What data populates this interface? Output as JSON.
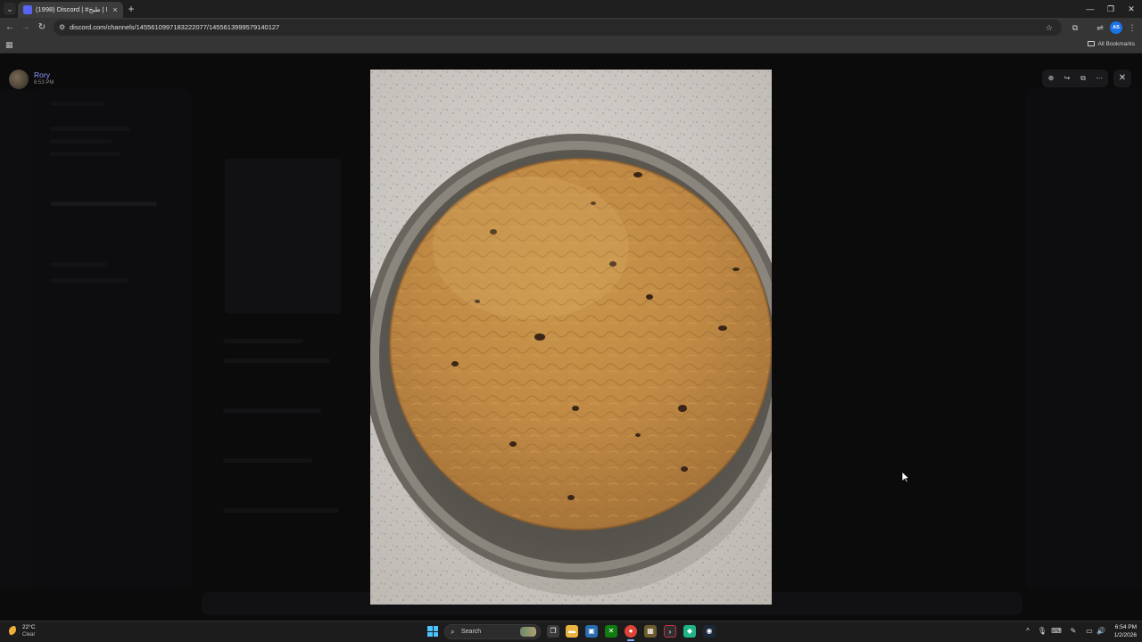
{
  "browser": {
    "tab": {
      "title": "(1998) Discord | #طبخ | MWV1...",
      "close": "×"
    },
    "new_tab": "+",
    "window_controls": {
      "minimize": "—",
      "restore": "❐",
      "close": "✕"
    },
    "nav": {
      "back": "←",
      "forward": "→",
      "reload": "↻"
    },
    "url": "discord.com/channels/1455610997183222077/1455613999579140127",
    "profile_initials": "AS",
    "bookmarks_label": "All Bookmarks"
  },
  "discord": {
    "poster_name": "Rory",
    "poster_time": "6:53 PM",
    "viewer_close": "✕",
    "viewer_tools": [
      "zoom-in-icon",
      "forward-icon",
      "open-external-icon",
      "more-icon"
    ]
  },
  "taskbar": {
    "weather_temp": "22°C",
    "weather_condition": "Clear",
    "search_label": "Search",
    "clock_time": "6:54 PM",
    "clock_date": "1/2/2026"
  },
  "colors": {
    "discord_accent": "#5865f2",
    "username": "#8f9bff",
    "windows_accent": "#4cc2ff"
  }
}
